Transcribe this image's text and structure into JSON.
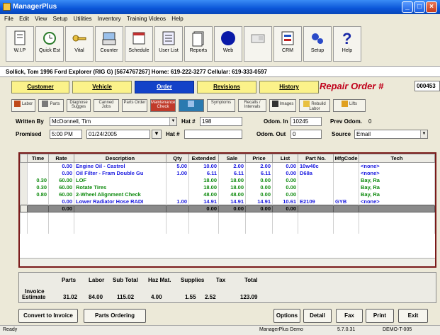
{
  "window": {
    "title": "ManagerPlus"
  },
  "menu": [
    "File",
    "Edit",
    "View",
    "Setup",
    "Utilities",
    "Inventory",
    "Training Videos",
    "Help"
  ],
  "toolbar": [
    {
      "label": "W.I.P",
      "icon": "document-icon"
    },
    {
      "label": "Quick Est",
      "icon": "clock-icon"
    },
    {
      "label": "Vital",
      "icon": "key-icon"
    },
    {
      "label": "Counter",
      "icon": "register-icon"
    },
    {
      "label": "Schedule",
      "icon": "calendar-icon"
    },
    {
      "label": "User List",
      "icon": "list-icon"
    },
    {
      "label": "Reports",
      "icon": "report-icon"
    },
    {
      "label": "Web",
      "icon": "globe-icon"
    },
    {
      "label": "",
      "icon": "card-icon"
    },
    {
      "label": "CRM",
      "icon": "crm-icon"
    },
    {
      "label": "Setup",
      "icon": "gears-icon"
    },
    {
      "label": "Help",
      "icon": "help-icon"
    }
  ],
  "customer_line": "Sollick, Tom   1996  Ford  Explorer  (RIG G)  [5674767267]   Home: 619-222-3277   Cellular: 619-333-0597",
  "tabs": [
    "Customer",
    "Vehicle",
    "Order",
    "Revisions",
    "History"
  ],
  "repair_order": {
    "label": "Repair Order #",
    "number": "000453"
  },
  "subbuttons": [
    "Labor",
    "Parts",
    "Diagnose Sugges",
    "Canned Jobs",
    "Parts Order",
    "Maintenance Check",
    "Symptoms",
    "Recalls / Intervals",
    "Images",
    "Rebuild Labor",
    "Lifts"
  ],
  "form": {
    "written_by_label": "Written By",
    "written_by": "McDonnell, Tim",
    "hat1_label": "Hat #",
    "hat1": "198",
    "odom_in_label": "Odom. In",
    "odom_in": "10245",
    "prev_odom_label": "Prev Odom.",
    "prev_odom": "0",
    "promised_label": "Promised",
    "promised_time": "5:00 PM",
    "promised_date": "01/24/2005",
    "hat2_label": "Hat #",
    "hat2": "",
    "odom_out_label": "Odom. Out",
    "odom_out": "0",
    "source_label": "Source",
    "source": "Email"
  },
  "grid": {
    "columns": [
      "Time",
      "Rate",
      "Description",
      "Qty",
      "Extended",
      "Sale",
      "Price",
      "List",
      "Part No.",
      "MfgCode",
      "Tech"
    ],
    "rows": [
      {
        "style": "blue",
        "cells": [
          "",
          "0.00",
          "Engine Oil - Castrol",
          "5.00",
          "10.00",
          "2.00",
          "2.00",
          "0.00",
          "10w40c",
          "",
          "<none>"
        ]
      },
      {
        "style": "blue",
        "cells": [
          "",
          "0.00",
          "Oil Filter - Fram Double Gu",
          "1.00",
          "6.11",
          "6.11",
          "6.11",
          "0.00",
          "D68a",
          "",
          "<none>"
        ]
      },
      {
        "style": "green",
        "cells": [
          "0.30",
          "60.00",
          "LOF",
          "",
          "18.00",
          "18.00",
          "0.00",
          "0.00",
          "",
          "",
          "Bay, Ra"
        ]
      },
      {
        "style": "green",
        "cells": [
          "0.30",
          "60.00",
          "Rotate Tires",
          "",
          "18.00",
          "18.00",
          "0.00",
          "0.00",
          "",
          "",
          "Bay, Ra"
        ]
      },
      {
        "style": "green",
        "cells": [
          "0.80",
          "60.00",
          "2-Wheel Alignment Check",
          "",
          "48.00",
          "48.00",
          "0.00",
          "0.00",
          "",
          "",
          "Bay, Ra"
        ]
      },
      {
        "style": "blue",
        "cells": [
          "",
          "0.00",
          "Lower Radiator Hose RADI",
          "1.00",
          "14.91",
          "14.91",
          "14.91",
          "10.61",
          "E2109",
          "GYB",
          "<none>"
        ]
      },
      {
        "style": "total",
        "cells": [
          "",
          "0.00",
          "",
          "",
          "0.00",
          "0.00",
          "0.00",
          "0.00",
          "",
          "",
          ""
        ]
      }
    ]
  },
  "summary": {
    "headers": [
      "Parts",
      "Labor",
      "Sub Total",
      "Haz Mat.",
      "Supplies",
      "Tax",
      "Total"
    ],
    "row_labels": [
      "Invoice",
      "Estimate"
    ],
    "estimate": [
      "31.02",
      "84.00",
      "115.02",
      "4.00",
      "1.55",
      "2.52",
      "123.09"
    ]
  },
  "buttons": {
    "convert": "Convert to Invoice",
    "parts_ordering": "Parts Ordering",
    "options": "Options",
    "detail": "Detail",
    "fax": "Fax",
    "print": "Print",
    "exit": "Exit"
  },
  "status": {
    "left": "Ready",
    "company": "ManagerPlus Demo",
    "version": "5.7.0.31",
    "code": "DEMO-T-005"
  }
}
